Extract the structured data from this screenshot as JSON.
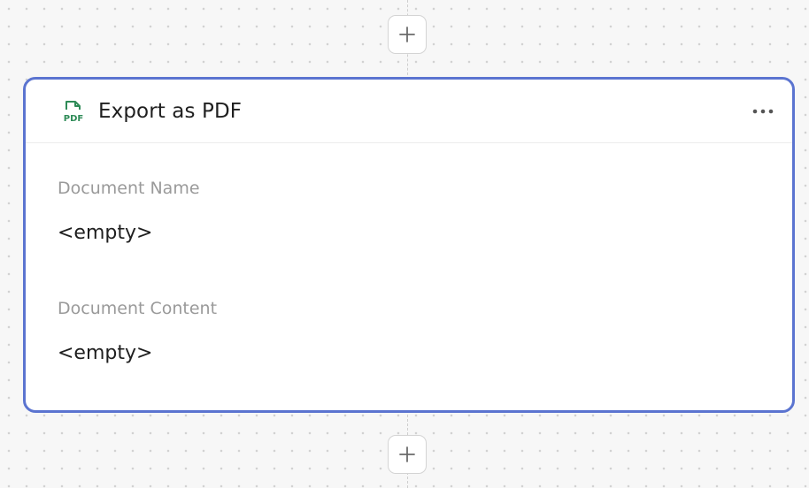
{
  "node": {
    "title": "Export as PDF",
    "icon": "pdf-file-icon",
    "icon_text": "PDF",
    "menu_icon": "more-horizontal-icon",
    "fields": [
      {
        "label": "Document Name",
        "value": "<empty>"
      },
      {
        "label": "Document Content",
        "value": "<empty>"
      }
    ]
  },
  "add_buttons": {
    "icon": "plus-icon"
  },
  "colors": {
    "card_border": "#5b74d0",
    "icon_green": "#2e8b57",
    "label_gray": "#9a9a9a",
    "text_dark": "#1f1f1f"
  }
}
